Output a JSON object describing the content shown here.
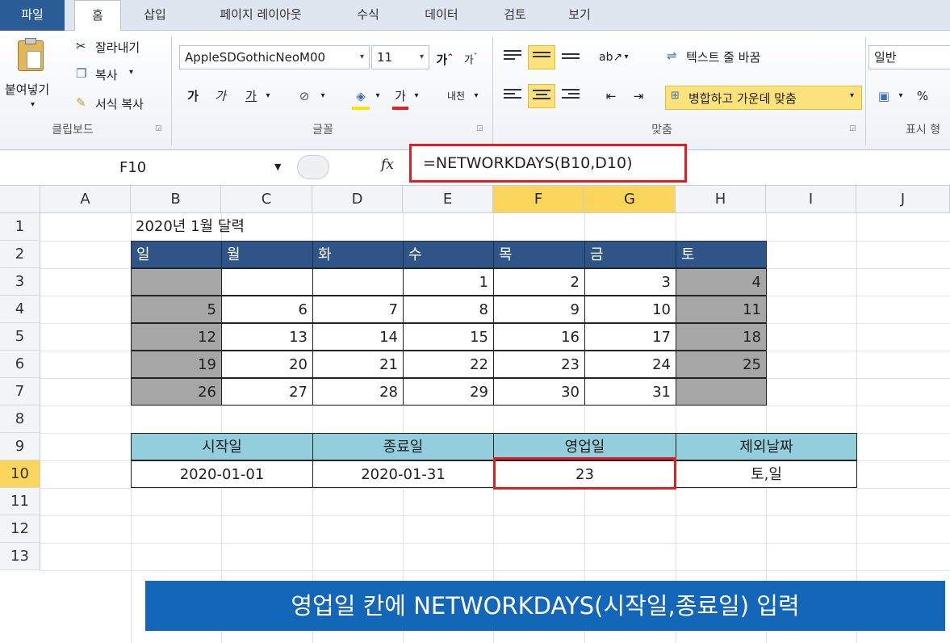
{
  "ribbon": {
    "tabs": [
      "파일",
      "홈",
      "삽입",
      "페이지 레이아웃",
      "수식",
      "데이터",
      "검토",
      "보기"
    ],
    "clipboard": {
      "paste": "붙여넣기",
      "cut": "잘라내기",
      "copy": "복사",
      "format_painter": "서식 복사",
      "group_label": "클립보드"
    },
    "font": {
      "name": "AppleSDGothicNeoM00",
      "size": "11",
      "bold": "가",
      "italic": "가",
      "underline": "가",
      "color_btn": "가",
      "group_label": "글꼴"
    },
    "alignment": {
      "wrap_text": "텍스트 줄 바꿈",
      "merge_center": "병합하고 가운데 맞춤",
      "group_label": "맞춤"
    },
    "number": {
      "format": "일반",
      "percent": "%",
      "group_label": "표시 형"
    }
  },
  "formula_bar": {
    "name_box": "F10",
    "formula": "=NETWORKDAYS(B10,D10)"
  },
  "sheet": {
    "columns": [
      "A",
      "B",
      "C",
      "D",
      "E",
      "F",
      "G",
      "H",
      "I",
      "J"
    ],
    "rows": [
      "1",
      "2",
      "3",
      "4",
      "5",
      "6",
      "7",
      "8",
      "9",
      "10",
      "11",
      "12",
      "13"
    ],
    "title": "2020년 1월 달력",
    "weekdays": [
      "일",
      "월",
      "화",
      "수",
      "목",
      "금",
      "토"
    ],
    "calendar": [
      [
        "",
        "",
        "",
        "1",
        "2",
        "3",
        "4"
      ],
      [
        "5",
        "6",
        "7",
        "8",
        "9",
        "10",
        "11"
      ],
      [
        "12",
        "13",
        "14",
        "15",
        "16",
        "17",
        "18"
      ],
      [
        "19",
        "20",
        "21",
        "22",
        "23",
        "24",
        "25"
      ],
      [
        "26",
        "27",
        "28",
        "29",
        "30",
        "31",
        ""
      ]
    ],
    "summary_headers": [
      "시작일",
      "종료일",
      "영업일",
      "제외날짜"
    ],
    "summary_values": [
      "2020-01-01",
      "2020-01-31",
      "23",
      "토,일"
    ]
  },
  "caption": "영업일 칸에 NETWORKDAYS(시작일,종료일) 입력",
  "colors": {
    "calendar_header": "#2f5488",
    "weekend_fill": "#a6a6a6",
    "summary_header": "#93cedc",
    "highlight": "#e02020",
    "caption_bg": "#1466b8"
  }
}
